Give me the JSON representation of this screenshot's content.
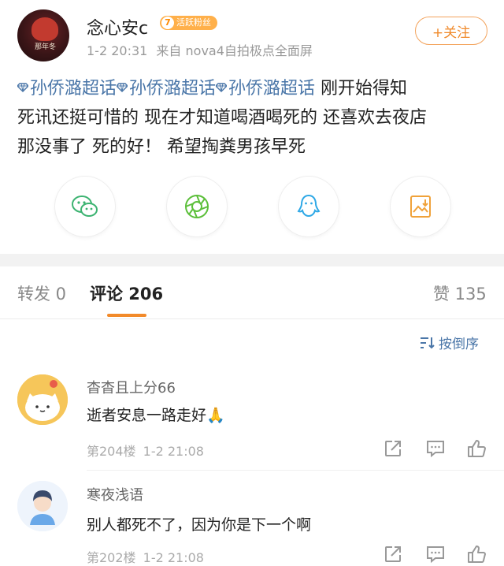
{
  "post": {
    "username": "念心安c",
    "fan_level": "7",
    "fan_badge": "活跃粉丝",
    "time": "1-2 20:31",
    "source": "来自 nova4自拍极点全面屏",
    "follow_label": "+关注",
    "avatar_caption": "那年冬",
    "topics": [
      "孙侨潞超话",
      "孙侨潞超话",
      "孙侨潞超话"
    ],
    "line1_rest": " 刚开始得知",
    "line2": "死讯还挺可惜的 现在才知道喝酒喝死的 还喜欢去夜店",
    "line3": "那没事了 死的好！   希望掏粪男孩早死"
  },
  "share": {
    "icons": [
      "wechat-icon",
      "moments-icon",
      "qq-icon",
      "save-image-icon"
    ]
  },
  "tabs": {
    "repost": "转发 0",
    "comments": "评论 206",
    "likes": "赞 135"
  },
  "sort_label": "按倒序",
  "comments": [
    {
      "name": "杳杳且上分66",
      "text": "逝者安息一路走好🙏",
      "floor": "第204楼",
      "time": "1-2 21:08"
    },
    {
      "name": "寒夜浅语",
      "text": "别人都死不了，因为你是下一个啊",
      "floor": "第202楼",
      "time": "1-2 21:08"
    }
  ],
  "colors": {
    "accent": "#f28a2a",
    "topic": "#4a76a8",
    "badge": "#ffb04a"
  }
}
